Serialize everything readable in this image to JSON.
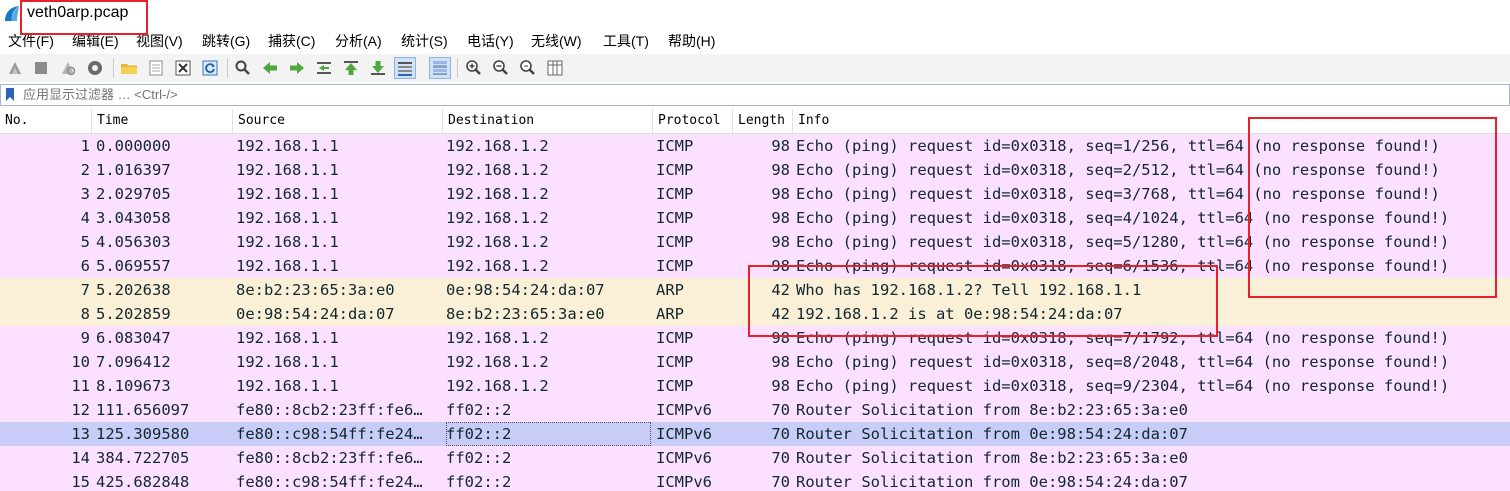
{
  "window": {
    "title": "veth0arp.pcap"
  },
  "menu": [
    "文件(F)",
    "编辑(E)",
    "视图(V)",
    "跳转(G)",
    "捕获(C)",
    "分析(A)",
    "统计(S)",
    "电话(Y)",
    "无线(W)",
    "工具(T)",
    "帮助(H)"
  ],
  "toolbar_icons": [
    "start-capture-icon",
    "stop-capture-icon",
    "restart-capture-icon",
    "capture-options-icon",
    "open-file-icon",
    "save-file-icon",
    "close-file-icon",
    "reload-file-icon",
    "find-packet-icon",
    "go-back-icon",
    "go-forward-icon",
    "go-to-packet-icon",
    "first-packet-icon",
    "last-packet-icon",
    "auto-scroll-icon",
    "colorize-icon",
    "zoom-in-icon",
    "zoom-out-icon",
    "normal-size-icon",
    "resize-columns-icon"
  ],
  "filter": {
    "placeholder": "应用显示过滤器 … <Ctrl-/>"
  },
  "columns": {
    "no": "No.",
    "time": "Time",
    "source": "Source",
    "destination": "Destination",
    "protocol": "Protocol",
    "length": "Length",
    "info": "Info"
  },
  "colors": {
    "icmp_row": "#fce0ff",
    "arp_row": "#faf0d7",
    "selected_row": "#c8cdf7",
    "annotation": "#e8202a"
  },
  "packets": [
    {
      "no": "1",
      "time": "0.000000",
      "source": "192.168.1.1",
      "destination": "192.168.1.2",
      "protocol": "ICMP",
      "length": "98",
      "info": "Echo (ping) request  id=0x0318, seq=1/256, ttl=64 (no response found!)",
      "kind": "icmp"
    },
    {
      "no": "2",
      "time": "1.016397",
      "source": "192.168.1.1",
      "destination": "192.168.1.2",
      "protocol": "ICMP",
      "length": "98",
      "info": "Echo (ping) request  id=0x0318, seq=2/512, ttl=64 (no response found!)",
      "kind": "icmp"
    },
    {
      "no": "3",
      "time": "2.029705",
      "source": "192.168.1.1",
      "destination": "192.168.1.2",
      "protocol": "ICMP",
      "length": "98",
      "info": "Echo (ping) request  id=0x0318, seq=3/768, ttl=64 (no response found!)",
      "kind": "icmp"
    },
    {
      "no": "4",
      "time": "3.043058",
      "source": "192.168.1.1",
      "destination": "192.168.1.2",
      "protocol": "ICMP",
      "length": "98",
      "info": "Echo (ping) request  id=0x0318, seq=4/1024, ttl=64 (no response found!)",
      "kind": "icmp"
    },
    {
      "no": "5",
      "time": "4.056303",
      "source": "192.168.1.1",
      "destination": "192.168.1.2",
      "protocol": "ICMP",
      "length": "98",
      "info": "Echo (ping) request  id=0x0318, seq=5/1280, ttl=64 (no response found!)",
      "kind": "icmp"
    },
    {
      "no": "6",
      "time": "5.069557",
      "source": "192.168.1.1",
      "destination": "192.168.1.2",
      "protocol": "ICMP",
      "length": "98",
      "info": "Echo (ping) request  id=0x0318, seq=6/1536, ttl=64 (no response found!)",
      "kind": "icmp"
    },
    {
      "no": "7",
      "time": "5.202638",
      "source": "8e:b2:23:65:3a:e0",
      "destination": "0e:98:54:24:da:07",
      "protocol": "ARP",
      "length": "42",
      "info": "Who has 192.168.1.2? Tell 192.168.1.1",
      "kind": "arp"
    },
    {
      "no": "8",
      "time": "5.202859",
      "source": "0e:98:54:24:da:07",
      "destination": "8e:b2:23:65:3a:e0",
      "protocol": "ARP",
      "length": "42",
      "info": "192.168.1.2 is at 0e:98:54:24:da:07",
      "kind": "arp"
    },
    {
      "no": "9",
      "time": "6.083047",
      "source": "192.168.1.1",
      "destination": "192.168.1.2",
      "protocol": "ICMP",
      "length": "98",
      "info": "Echo (ping) request  id=0x0318, seq=7/1792, ttl=64 (no response found!)",
      "kind": "icmp"
    },
    {
      "no": "10",
      "time": "7.096412",
      "source": "192.168.1.1",
      "destination": "192.168.1.2",
      "protocol": "ICMP",
      "length": "98",
      "info": "Echo (ping) request  id=0x0318, seq=8/2048, ttl=64 (no response found!)",
      "kind": "icmp"
    },
    {
      "no": "11",
      "time": "8.109673",
      "source": "192.168.1.1",
      "destination": "192.168.1.2",
      "protocol": "ICMP",
      "length": "98",
      "info": "Echo (ping) request  id=0x0318, seq=9/2304, ttl=64 (no response found!)",
      "kind": "icmp"
    },
    {
      "no": "12",
      "time": "111.656097",
      "source": "fe80::8cb2:23ff:fe6…",
      "destination": "ff02::2",
      "protocol": "ICMPv6",
      "length": "70",
      "info": "Router Solicitation from 8e:b2:23:65:3a:e0",
      "kind": "icmp"
    },
    {
      "no": "13",
      "time": "125.309580",
      "source": "fe80::c98:54ff:fe24…",
      "destination": "ff02::2",
      "protocol": "ICMPv6",
      "length": "70",
      "info": "Router Solicitation from 0e:98:54:24:da:07",
      "kind": "selected"
    },
    {
      "no": "14",
      "time": "384.722705",
      "source": "fe80::8cb2:23ff:fe6…",
      "destination": "ff02::2",
      "protocol": "ICMPv6",
      "length": "70",
      "info": "Router Solicitation from 8e:b2:23:65:3a:e0",
      "kind": "icmp"
    },
    {
      "no": "15",
      "time": "425.682848",
      "source": "fe80::c98:54ff:fe24…",
      "destination": "ff02::2",
      "protocol": "ICMPv6",
      "length": "70",
      "info": "Router Solicitation from 0e:98:54:24:da:07",
      "kind": "icmp"
    }
  ]
}
